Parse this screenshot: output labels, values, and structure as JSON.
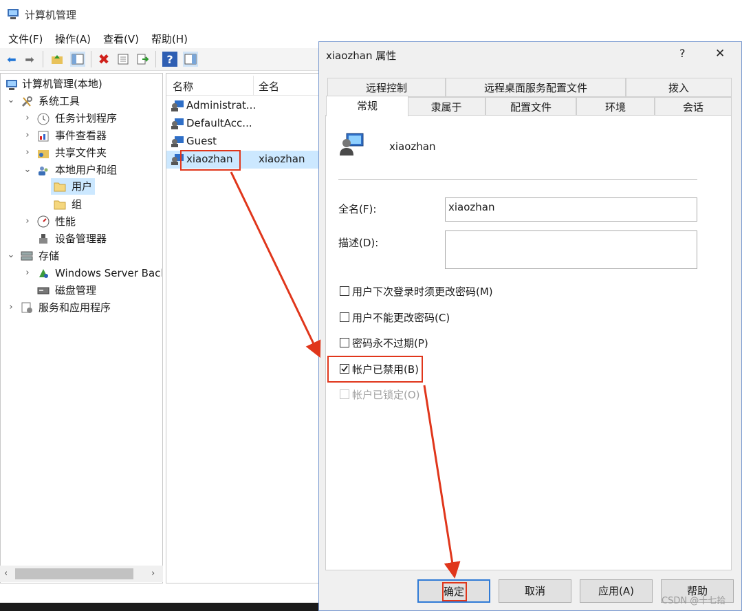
{
  "window": {
    "title": "计算机管理"
  },
  "menu": [
    "文件(F)",
    "操作(A)",
    "查看(V)",
    "帮助(H)"
  ],
  "toolbar_icons": [
    "back-icon",
    "forward-icon",
    "up-folder-icon",
    "show-hide-tree-icon",
    "delete-icon",
    "properties-icon",
    "export-icon",
    "help-icon",
    "action-pane-icon"
  ],
  "tree": {
    "root": "计算机管理(本地)",
    "system_tools": "系统工具",
    "task_scheduler": "任务计划程序",
    "event_viewer": "事件查看器",
    "shared_folders": "共享文件夹",
    "local_users": "本地用户和组",
    "users": "用户",
    "groups": "组",
    "performance": "性能",
    "device_manager": "设备管理器",
    "storage": "存储",
    "wsb": "Windows Server Back",
    "disk_management": "磁盘管理",
    "services_apps": "服务和应用程序"
  },
  "list": {
    "headers": [
      "名称",
      "全名"
    ],
    "rows": [
      {
        "name": "Administrat...",
        "fullname": ""
      },
      {
        "name": "DefaultAcc...",
        "fullname": ""
      },
      {
        "name": "Guest",
        "fullname": ""
      },
      {
        "name": "xiaozhan",
        "fullname": "xiaozhan"
      }
    ]
  },
  "dialog": {
    "title": "xiaozhan 属性",
    "help_glyph": "?",
    "close_glyph": "✕",
    "tabs_row1": [
      "远程控制",
      "远程桌面服务配置文件",
      "拨入"
    ],
    "tabs_row2": [
      "常规",
      "隶属于",
      "配置文件",
      "环境",
      "会话"
    ],
    "username": "xiaozhan",
    "fullname_label": "全名(F):",
    "fullname_value": "xiaozhan",
    "desc_label": "描述(D):",
    "desc_value": "",
    "checkboxes": [
      {
        "label": "用户下次登录时须更改密码(M)",
        "checked": false,
        "disabled": false
      },
      {
        "label": "用户不能更改密码(C)",
        "checked": false,
        "disabled": false
      },
      {
        "label": "密码永不过期(P)",
        "checked": false,
        "disabled": false
      },
      {
        "label": "帐户已禁用(B)",
        "checked": true,
        "disabled": false
      },
      {
        "label": "帐户已锁定(O)",
        "checked": false,
        "disabled": true
      }
    ],
    "buttons": {
      "ok": "确定",
      "cancel": "取消",
      "apply": "应用(A)",
      "help": "帮助"
    }
  },
  "watermark": "CSDN @十七拾",
  "colors": {
    "annotation": "#e0361b",
    "selection": "#cce8ff"
  }
}
